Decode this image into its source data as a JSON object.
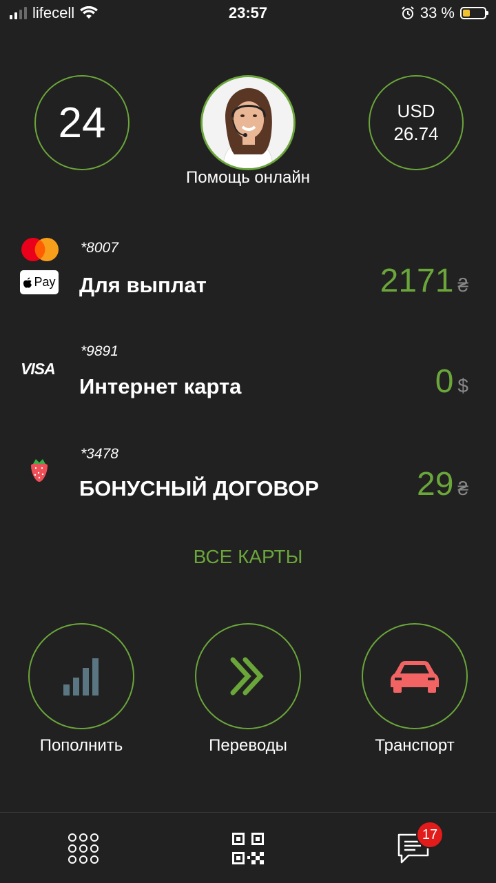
{
  "status_bar": {
    "carrier": "lifecell",
    "time": "23:57",
    "battery_percent": "33 %",
    "battery_level": 0.33,
    "signal_bars": 2,
    "icons": [
      "signal-icon",
      "wifi-icon",
      "alarm-icon",
      "battery-charging-icon"
    ]
  },
  "header": {
    "count": "24",
    "currency": "USD",
    "rate": "26.74",
    "support_label": "Помощь онлайн"
  },
  "accounts": [
    {
      "number": "*8007",
      "name": "Для выплат",
      "amount": "2171",
      "currency": "₴",
      "icons": [
        "mastercard-icon",
        "apple-pay-icon"
      ],
      "apple_pay_label": "Pay"
    },
    {
      "number": "*9891",
      "name": "Интернет карта",
      "amount": "0",
      "currency": "$",
      "icons": [
        "visa-icon"
      ],
      "visa_label": "VISA"
    },
    {
      "number": "*3478",
      "name": "БОНУСНЫЙ ДОГОВОР",
      "amount": "29",
      "currency": "₴",
      "icons": [
        "strawberry-icon"
      ]
    }
  ],
  "all_cards_label": "ВСЕ КАРТЫ",
  "actions": [
    {
      "label": "Пополнить",
      "icon": "signal-bars-icon"
    },
    {
      "label": "Переводы",
      "icon": "double-chevron-icon"
    },
    {
      "label": "Транспорт",
      "icon": "car-icon"
    }
  ],
  "bottom_nav": {
    "icons": [
      "menu-grid-icon",
      "qr-code-icon",
      "chat-icon"
    ],
    "chat_badge": "17"
  },
  "colors": {
    "background": "#212121",
    "accent": "#6aa63a",
    "badge": "#e21b1b",
    "car": "#f26464",
    "bars": "#5b7683"
  }
}
